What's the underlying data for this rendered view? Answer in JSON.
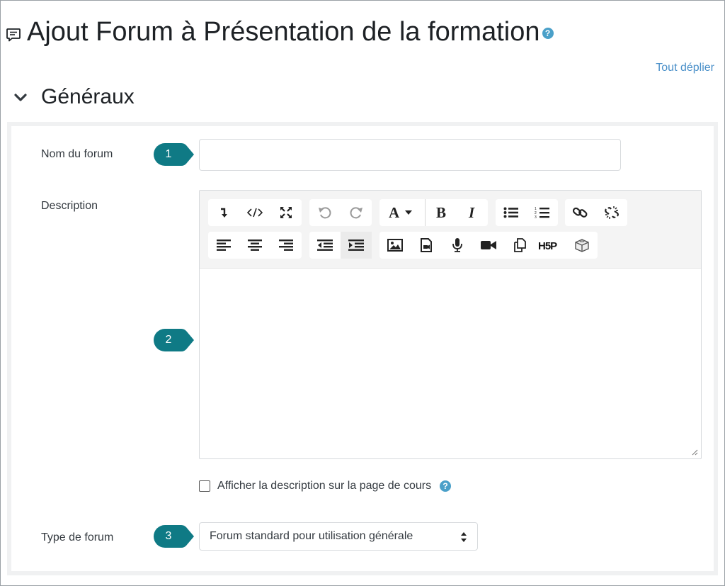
{
  "page": {
    "title": "Ajout Forum à Présentation de la formation",
    "help_icon": "question-circle-icon",
    "title_icon": "forum-icon",
    "expand_all": "Tout déplier"
  },
  "section": {
    "title": "Généraux"
  },
  "form": {
    "forum_name_label": "Nom du forum",
    "forum_name_value": "",
    "description_label": "Description",
    "show_description_label": "Afficher la description sur la page de cours",
    "show_description_checked": false,
    "forum_type_label": "Type de forum",
    "forum_type_value": "Forum standard pour utilisation générale"
  },
  "markers": [
    "1",
    "2",
    "3"
  ],
  "toolbar": {
    "row1": [
      [
        "collapse-icon",
        "html-icon",
        "fullscreen-icon"
      ],
      [
        "undo-icon",
        "redo-icon"
      ],
      [
        "font-color-icon",
        "bold-icon",
        "italic-icon"
      ],
      [
        "unordered-list-icon",
        "ordered-list-icon"
      ],
      [
        "link-icon",
        "unlink-icon"
      ]
    ],
    "row2": [
      [
        "align-left-icon",
        "align-center-icon",
        "align-right-icon"
      ],
      [
        "outdent-icon",
        "indent-icon"
      ],
      [
        "image-icon",
        "media-icon",
        "record-audio-icon",
        "record-video-icon",
        "manage-files-icon",
        "h5p-icon",
        "emoji-block-icon"
      ]
    ],
    "h5p_text": "H5P"
  },
  "colors": {
    "marker": "#0f7a85",
    "link": "#4a90c9",
    "help": "#4aa0c9"
  }
}
